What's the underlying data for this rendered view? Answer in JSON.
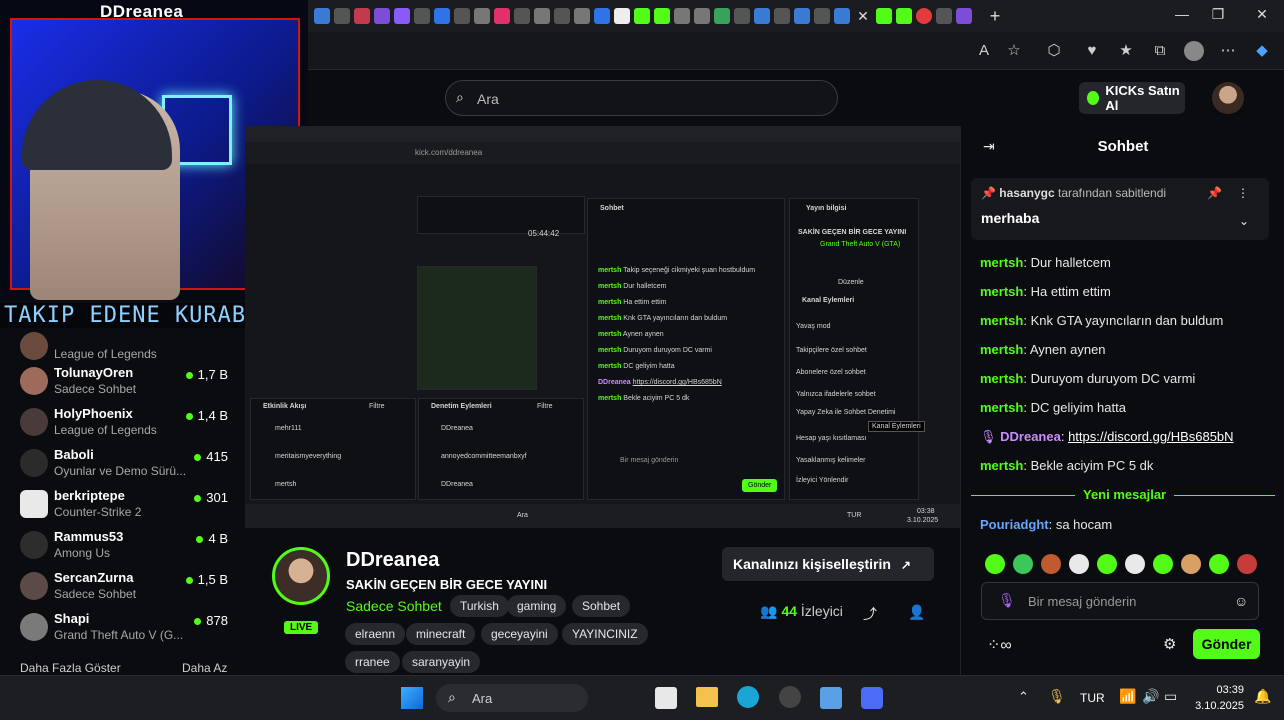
{
  "cam_overlay": {
    "title": "DDreanea",
    "banner_text": "TAKIP EDENE KURABIYE"
  },
  "header": {
    "search_placeholder": "Ara",
    "kicks_button": "KICKs Satın Al"
  },
  "sidebar": {
    "items": [
      {
        "name": "",
        "category": "League of Legends",
        "viewers": ""
      },
      {
        "name": "TolunayOren",
        "category": "Sadece Sohbet",
        "viewers": "1,7 B"
      },
      {
        "name": "HolyPhoenix",
        "category": "League of Legends",
        "viewers": "1,4 B"
      },
      {
        "name": "Baboli",
        "category": "Oyunlar ve Demo Sürü...",
        "viewers": "415"
      },
      {
        "name": "berkriptepe",
        "category": "Counter-Strike 2",
        "viewers": "301"
      },
      {
        "name": "Rammus53",
        "category": "Among Us",
        "viewers": "4 B"
      },
      {
        "name": "SercanZurna",
        "category": "Sadece Sohbet",
        "viewers": "1,5 B"
      },
      {
        "name": "Shapi",
        "category": "Grand Theft Auto V (G...",
        "viewers": "878"
      }
    ],
    "show_more": "Daha Fazla Göster",
    "show_less": "Daha Az"
  },
  "video": {
    "address": "kick.com/ddreanea",
    "time": "05:44:42",
    "chat_title": "Sohbet",
    "info_title": "Yayın bilgisi",
    "info_stream_title": "SAKİN GEÇEN BİR GECE YAYINI",
    "info_game": "Grand Theft Auto V (GTA)",
    "info_edit": "Düzenle",
    "actions_title": "Kanal Eylemleri",
    "actions": [
      "Yavaş mod",
      "Takipçilere özel sohbet",
      "Abonelere özel sohbet",
      "Yalnızca ifadelerle sohbet",
      "Yapay Zeka ile Sohbet Denetimi",
      "Hesap yaşı kısıtlaması",
      "Yasaklanmış kelimeler",
      "İzleyici Yönlendir"
    ],
    "tooltip": "Kanal Eylemleri",
    "activity_title": "Etkinlik Akışı",
    "activity_filter": "Filtre",
    "activity": [
      "mehr111",
      "meritaismyeverything",
      "mertsh"
    ],
    "mod_title": "Denetim Eylemleri",
    "mod_filter": "Filtre",
    "mod_rows": [
      "DDreanea",
      "annoyedcommitteemanbxyf",
      "DDreanea"
    ],
    "mini_chat": [
      {
        "user": "mertsh",
        "text": "Takip seçeneği cikmiyeki şuan hostbuldum"
      },
      {
        "user": "mertsh",
        "text": "Dur halletcem"
      },
      {
        "user": "mertsh",
        "text": "Ha ettim ettim"
      },
      {
        "user": "mertsh",
        "text": "Knk GTA yayıncıların dan buldum"
      },
      {
        "user": "mertsh",
        "text": "Aynen aynen"
      },
      {
        "user": "mertsh",
        "text": "Duruyom duruyom DC varmi"
      },
      {
        "user": "mertsh",
        "text": "DC geliyim hatta"
      },
      {
        "user": "DDreanea",
        "text": "https://discord.gg/HBs685bN"
      },
      {
        "user": "mertsh",
        "text": "Bekle aciyim PC 5 dk"
      }
    ],
    "mini_send": "Gönder",
    "mini_input": "Bir mesaj gönderin",
    "mini_search": "Ara",
    "mini_lang": "TUR",
    "mini_clock": "03:38",
    "mini_date": "3.10.2025"
  },
  "stream": {
    "name": "DDreanea",
    "title": "SAKİN GEÇEN BİR GECE YAYINI",
    "category": "Sadece Sohbet",
    "live": "LIVE",
    "tags": [
      "Turkish",
      "gaming",
      "Sohbet",
      "elraenn",
      "minecraft",
      "geceyayini",
      "YAYINCINIZ",
      "rraneе",
      "saranyayin"
    ],
    "customize_button": "Kanalınızı kişiselleştirin",
    "viewers_count": "44",
    "viewers_label": "İzleyici"
  },
  "chat": {
    "title": "Sohbet",
    "pinned_by": "hasanygc",
    "pinned_suffix": "tarafından sabitlendi",
    "pinned_message": "merhaba",
    "messages": [
      {
        "user": "mertsh",
        "text": "Dur halletcem"
      },
      {
        "user": "mertsh",
        "text": "Ha ettim ettim"
      },
      {
        "user": "mertsh",
        "text": "Knk GTA yayıncıların dan buldum"
      },
      {
        "user": "mertsh",
        "text": "Aynen aynen"
      },
      {
        "user": "mertsh",
        "text": "Duruyom duruyom DC varmi"
      },
      {
        "user": "mertsh",
        "text": "DC geliyim hatta"
      },
      {
        "user": "DDreanea",
        "text": "https://discord.gg/HBs685bN"
      },
      {
        "user": "mertsh",
        "text": "Bekle aciyim PC 5 dk"
      }
    ],
    "new_messages": "Yeni mesajlar",
    "after_messages": [
      {
        "user": "Pouriadght",
        "text": "sa hocam"
      }
    ],
    "input_placeholder": "Bir mesaj gönderin",
    "send_button": "Gönder"
  },
  "taskbar": {
    "search": "Ara",
    "language": "TUR",
    "time": "03:39",
    "date": "3.10.2025"
  },
  "colors": {
    "kick_green": "#53fc18",
    "background": "#0b0c0f",
    "cam_border": "#d31414"
  }
}
